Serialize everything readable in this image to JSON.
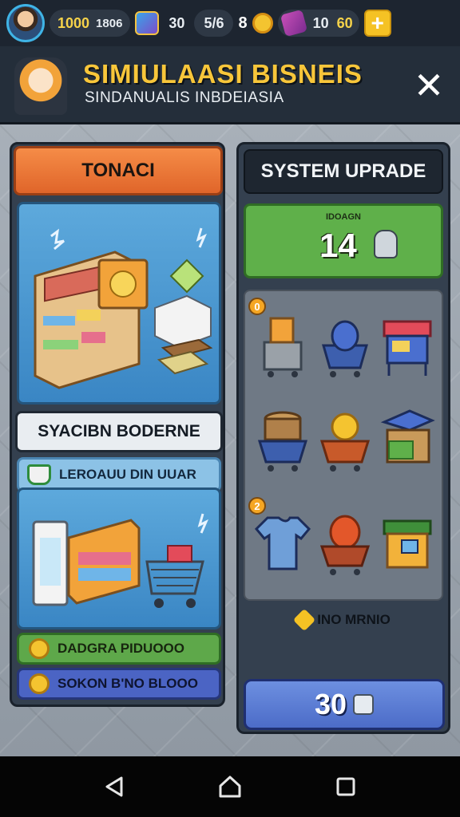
{
  "top_bar": {
    "currency_1": "1000",
    "currency_1_sub": "1806",
    "level": "30",
    "level_sub": "5/6",
    "medals": "8",
    "gems": "10",
    "gold": "60",
    "plus_label": "+"
  },
  "header": {
    "title": "SIMIULAASI BISNEIS",
    "subtitle": "SINDANUALIS INBDEIASIA",
    "close_label": "✕"
  },
  "left_panel": {
    "tab_label": "TONACI",
    "section_title": "SYACIBN BODERNE",
    "info_row": "LEROAUU DIN UUAR",
    "green_button": "DADGRA PIDUOOO",
    "blue_button": "SOKON B'NO BLOOO"
  },
  "right_panel": {
    "header_label": "SYSTEM UPRADE",
    "green_box_label": "IDOAGN",
    "green_box_value": "14",
    "item_badge_1": "0",
    "item_badge_2": "2",
    "info_label": "INO MRNIO",
    "buy_button_value": "30"
  },
  "colors": {
    "accent_orange": "#f58c47",
    "accent_green": "#5fb04a",
    "accent_blue": "#4b64c4",
    "title_gold": "#f8c63a"
  }
}
